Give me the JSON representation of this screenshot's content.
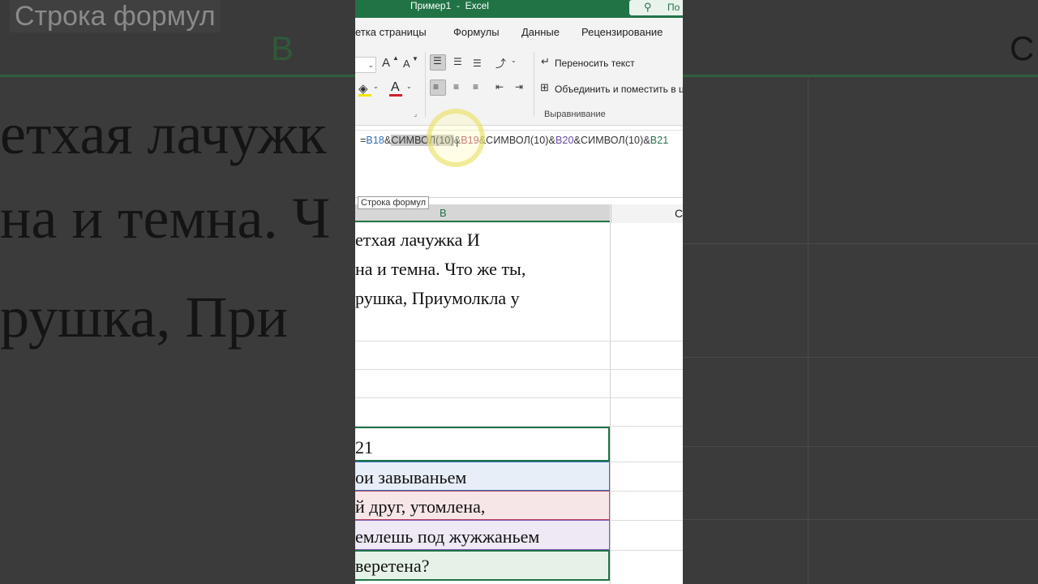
{
  "background": {
    "formula_bar_tooltip": "Строка формул",
    "column_b": "B",
    "column_c": "C",
    "lines": [
      "етхая лачужк",
      "на и темна. Ч",
      "рушка, При"
    ]
  },
  "window": {
    "title": "Пример1  -  Excel",
    "search_label": "По"
  },
  "ribbon": {
    "tabs": [
      "Разметка страницы",
      "Формулы",
      "Данные",
      "Рецензирование"
    ],
    "tab_visible_text": [
      "етка страницы",
      "Формулы",
      "Данные",
      "Рецензирование"
    ],
    "wrap_text_label": "Переносить текст",
    "merge_label": "Объединить и поместить в ц",
    "alignment_group_label": "Выравнивание",
    "font_grow": "A",
    "font_shrink": "A",
    "font_color_letter": "A"
  },
  "formula_bar": {
    "parts": [
      {
        "text": "=",
        "kind": "plain"
      },
      {
        "text": "B18",
        "kind": "ref1"
      },
      {
        "text": "&",
        "kind": "plain"
      },
      {
        "text": "СИМВОЛ(10)",
        "kind": "selected"
      },
      {
        "text": "&",
        "kind": "plain"
      },
      {
        "text": "B19",
        "kind": "ref2"
      },
      {
        "text": "&СИМВОЛ(10)&",
        "kind": "plain"
      },
      {
        "text": "B20",
        "kind": "ref3"
      },
      {
        "text": "&СИМВОЛ(10)&",
        "kind": "plain"
      },
      {
        "text": "B21",
        "kind": "ref4"
      }
    ],
    "tooltip": "Строка формул"
  },
  "columns": {
    "b": "B",
    "c": "С"
  },
  "cells": {
    "merged_lines": [
      "етхая лачужка И",
      "на и темна. Что же ты,",
      "рушка, Приумолкла у"
    ],
    "row_b17": "21",
    "row_b18": "ои завываньем",
    "row_b19": "й друг, утомлена,",
    "row_b20": "емлешь под жужжаньем",
    "row_b21": "веретена?"
  },
  "colors": {
    "excel_green": "#217346",
    "ref_blue_fill": "#e8eef8",
    "ref_red_fill": "#f6e6e8",
    "ref_purple_fill": "#efe9f6",
    "ref_green_fill": "#e6f2e8"
  }
}
